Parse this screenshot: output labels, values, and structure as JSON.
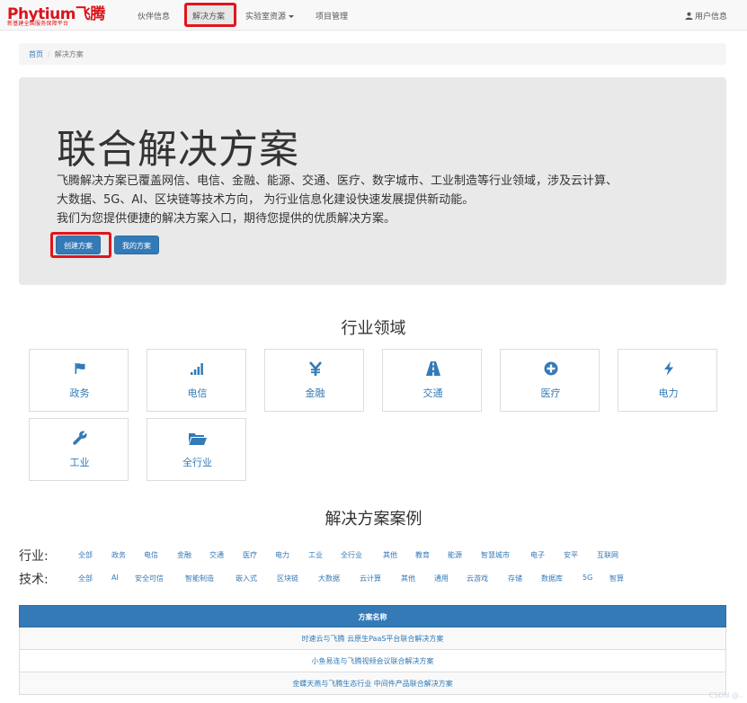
{
  "navbar": {
    "brand_main": "Phytium飞腾",
    "brand_sub": "新基建全国服务保障平台",
    "items": [
      {
        "label": "伙伴信息"
      },
      {
        "label": "解决方案"
      },
      {
        "label": "实验室资源"
      },
      {
        "label": "项目管理"
      }
    ],
    "user": "用户信息"
  },
  "breadcrumb": {
    "home": "首页",
    "separator": "/",
    "current": "解决方案"
  },
  "jumbotron": {
    "title": "联合解决方案",
    "line1": "飞腾解决方案已覆盖网信、电信、金融、能源、交通、医疗、数字城市、工业制造等行业领域，涉及云计算、",
    "line2": "大数据、5G、AI、区块链等技术方向， 为行业信息化建设快速发展提供新动能。",
    "line3": "我们为您提供便捷的解决方案入口，期待您提供的优质解决方案。",
    "create_button": "创建方案",
    "my_button": "我的方案"
  },
  "industry": {
    "title": "行业领域",
    "tiles": [
      {
        "label": "政务",
        "icon": "flag-icon"
      },
      {
        "label": "电信",
        "icon": "signal-icon"
      },
      {
        "label": "金融",
        "icon": "yen-icon"
      },
      {
        "label": "交通",
        "icon": "road-icon"
      },
      {
        "label": "医疗",
        "icon": "plus-circle-icon"
      },
      {
        "label": "电力",
        "icon": "flash-icon"
      },
      {
        "label": "工业",
        "icon": "wrench-icon"
      },
      {
        "label": "全行业",
        "icon": "folder-open-icon"
      }
    ]
  },
  "cases": {
    "title": "解决方案案例",
    "industry_label": "行业:",
    "industry_filters": [
      "全部",
      "政务",
      "电信",
      "金融",
      "交通",
      "医疗",
      "电力",
      "工业",
      "全行业",
      "其他",
      "教育",
      "能源",
      "智慧城市",
      "电子",
      "安平",
      "互联网"
    ],
    "tech_label": "技术:",
    "tech_filters": [
      "全部",
      "AI",
      "安全可信",
      "智能制造",
      "嵌入式",
      "区块链",
      "大数据",
      "云计算",
      "其他",
      "通用",
      "云游戏",
      "存储",
      "数据库",
      "5G",
      "智算"
    ]
  },
  "table": {
    "header": "方案名称",
    "rows": [
      "时速云与飞腾 云原生PaaS平台联合解决方案",
      "小鱼易连与飞腾视频会议联合解决方案",
      "金蝶天燕与飞腾生态行业 中间件产品联合解决方案"
    ]
  },
  "watermark": "CSDN @..",
  "colors": {
    "brand_red": "#d9141b",
    "highlight_red": "#e0161c",
    "primary_blue": "#337ab7",
    "jumbotron_gray": "#e9e9e9"
  }
}
